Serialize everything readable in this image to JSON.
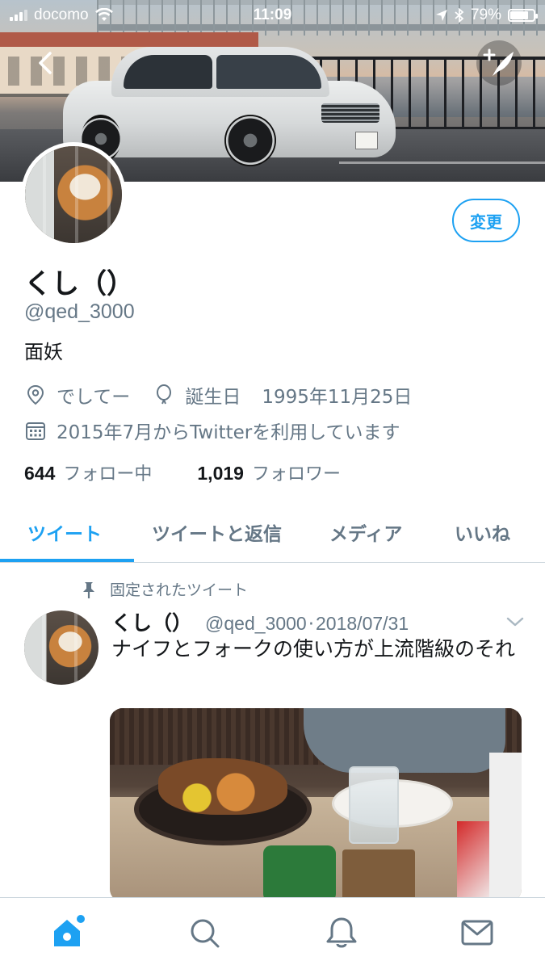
{
  "status_bar": {
    "carrier": "docomo",
    "time": "11:09",
    "battery_percent": "79%",
    "battery_level": 0.79,
    "icons": [
      "signal-icon",
      "wifi-icon",
      "location-arrow-icon",
      "bluetooth-icon",
      "battery-icon"
    ]
  },
  "header": {
    "back_icon": "chevron-left-icon",
    "compose_icon": "add-tweet-feather-icon"
  },
  "profile": {
    "edit_button": "変更",
    "display_name": "くし（）",
    "handle": "@qed_3000",
    "bio": "面妖",
    "location": "でしてー",
    "birthday_label": "誕生日",
    "birthday": "1995年11月25日",
    "joined": "2015年7月からTwitterを利用しています",
    "following_count": "644",
    "following_label": "フォロー中",
    "followers_count": "1,019",
    "followers_label": "フォロワー"
  },
  "tabs": [
    {
      "label": "ツイート",
      "active": true
    },
    {
      "label": "ツイートと返信",
      "active": false
    },
    {
      "label": "メディア",
      "active": false
    },
    {
      "label": "いいね",
      "active": false
    }
  ],
  "tweet": {
    "pinned_label": "固定されたツイート",
    "name": "くし（）",
    "handle": "@qed_3000",
    "separator": "·",
    "date": "2018/07/31",
    "text": "ナイフとフォークの使い方が上流階級のそれ"
  },
  "bottom_nav": [
    {
      "icon": "home-icon",
      "active": true
    },
    {
      "icon": "search-icon",
      "active": false
    },
    {
      "icon": "notifications-bell-icon",
      "active": false
    },
    {
      "icon": "messages-envelope-icon",
      "active": false
    }
  ],
  "colors": {
    "accent": "#1da1f2",
    "secondary_text": "#657786",
    "primary_text": "#14171a",
    "divider": "#ccd6dd"
  }
}
